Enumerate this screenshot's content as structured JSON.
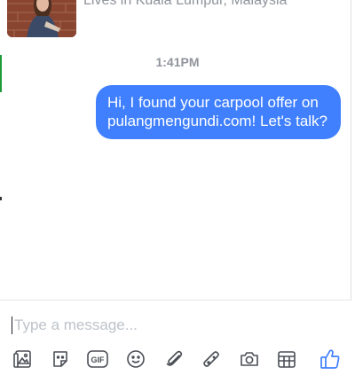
{
  "profile": {
    "location": "Lives in Kuala Lumpur, Malaysia"
  },
  "conversation": {
    "timestamp": "1:41PM",
    "messages": [
      {
        "sender": "me",
        "text": "Hi, I found your carpool offer on pulangmengundi.com! Let's talk?"
      }
    ]
  },
  "composer": {
    "placeholder": "Type a message...",
    "value": "",
    "tools": [
      "photo-icon",
      "sticker-icon",
      "gif-icon",
      "emoji-icon",
      "attachment-icon",
      "game-icon",
      "camera-icon",
      "plan-icon",
      "like-icon"
    ],
    "gif_label": "GIF"
  },
  "colors": {
    "bubble": "#4080ff",
    "icons": "#4b4f56",
    "like": "#4080ff",
    "timestamp": "#90949c"
  }
}
